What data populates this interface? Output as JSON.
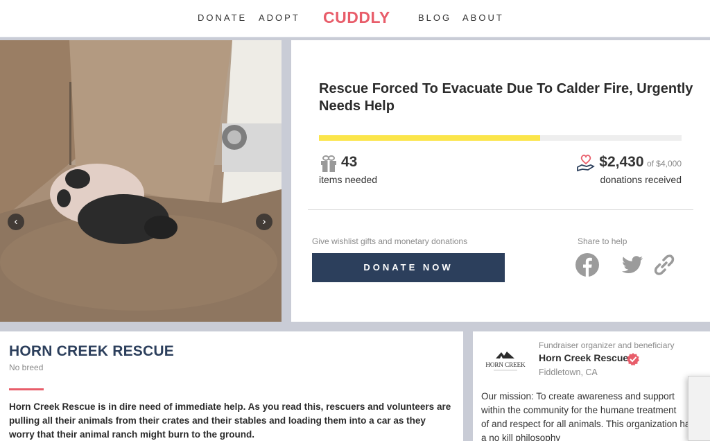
{
  "nav": {
    "donate": "DONATE",
    "adopt": "ADOPT",
    "logo": "CUDDLY",
    "blog": "BLOG",
    "about": "ABOUT"
  },
  "photo": {
    "prev_icon": "chevron-left-icon",
    "next_icon": "chevron-right-icon"
  },
  "fundraiser": {
    "title": "Rescue Forced To Evacuate Due To Calder Fire, Urgently Needs Help",
    "progress_fraction": 0.61,
    "items_needed": "43",
    "items_label": "items needed",
    "amount": "$2,430",
    "goal": "of $4,000",
    "donations_label": "donations received",
    "give_text": "Give wishlist gifts and monetary donations",
    "donate_button": "DONATE NOW",
    "share_text": "Share to help",
    "share_icons": [
      "facebook-icon",
      "twitter-icon",
      "link-icon"
    ]
  },
  "bio": {
    "title": "HORN CREEK RESCUE",
    "breed": "No breed",
    "text": "Horn Creek Rescue is in dire need of immediate help. As you read this, rescuers and volunteers are pulling all their animals from their crates and their stables and loading them into a car as they worry that their animal ranch might burn to the ground."
  },
  "organizer": {
    "logo_text": "HORN CREEK",
    "role": "Fundraiser organizer and beneficiary",
    "name": "Horn Creek Rescue",
    "location": "Fiddletown,  CA",
    "mission": "Our mission: To create awareness and support\nwithin the community for the humane treatment\nof and respect for all animals. This organization has\na no kill philosophy"
  },
  "colors": {
    "accent": "#e85d6a",
    "navy": "#2c3f5c",
    "progress": "#fbe54a"
  }
}
